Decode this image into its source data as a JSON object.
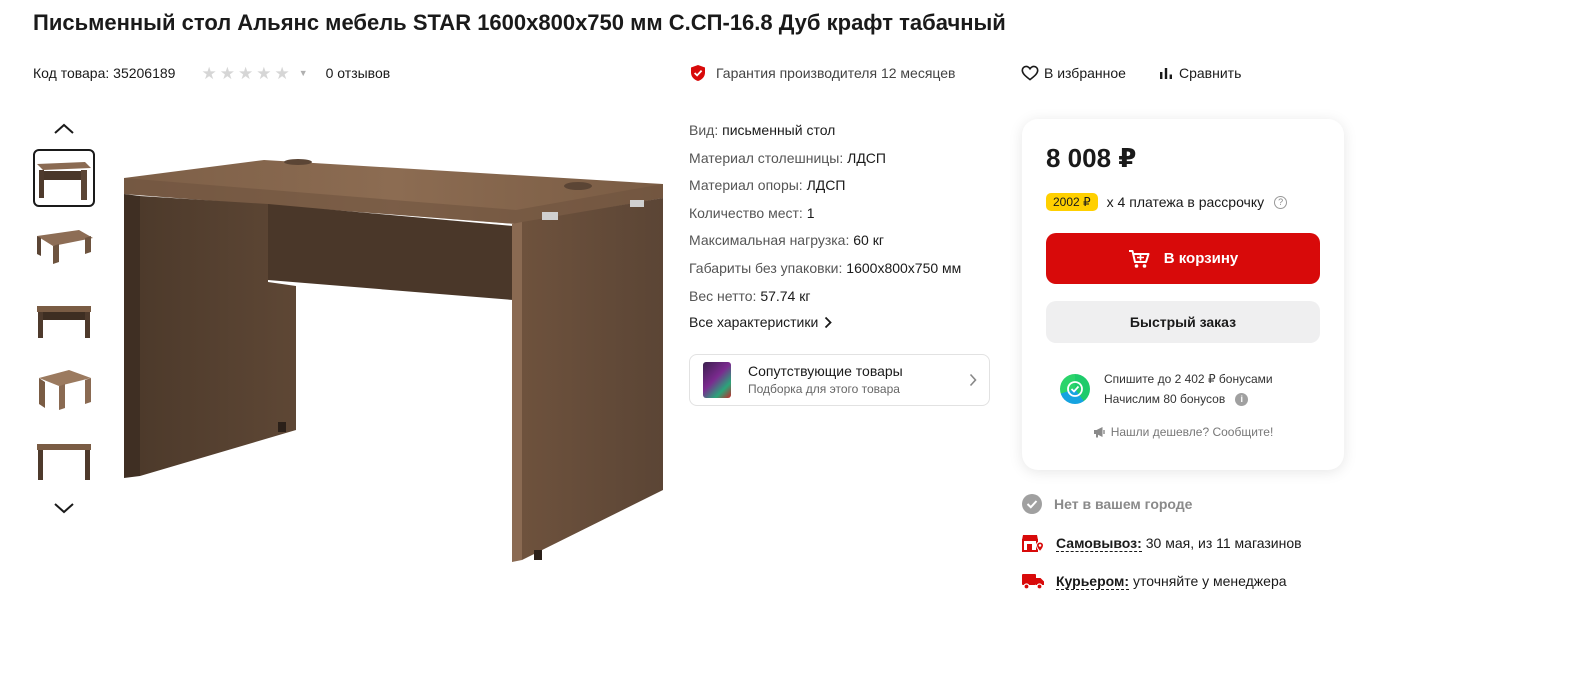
{
  "product": {
    "title": "Письменный стол Альянс мебель STAR 1600x800x750 мм С.СП-16.8 Дуб крафт табачный",
    "code_text": "Код товара: 35206189",
    "rating_stars": 0,
    "reviews_text": "0 отзывов",
    "warranty_text": "Гарантия производителя 12 месяцев",
    "favorite_label": "В избранное",
    "compare_label": "Сравнить"
  },
  "gallery": {
    "thumbnail_count": 5,
    "active_index": 0
  },
  "specs": [
    {
      "key": "Вид:",
      "value": "письменный стол"
    },
    {
      "key": "Материал столешницы:",
      "value": "ЛДСП"
    },
    {
      "key": "Материал опоры:",
      "value": "ЛДСП"
    },
    {
      "key": "Количество мест:",
      "value": "1"
    },
    {
      "key": "Максимальная нагрузка:",
      "value": "60 кг"
    },
    {
      "key": "Габариты без упаковки:",
      "value": "1600x800x750 мм"
    },
    {
      "key": "Вес нетто:",
      "value": "57.74 кг"
    }
  ],
  "all_specs_label": "Все характеристики",
  "related": {
    "title": "Сопутствующие товары",
    "subtitle": "Подборка для этого товара"
  },
  "buy": {
    "price": "8 008 ₽",
    "installment_badge": "2002 ₽",
    "installment_text": "х 4 платежа в рассрочку",
    "cart_label": "В корзину",
    "quick_order_label": "Быстрый заказ",
    "bonus_line1": "Спишите до 2 402 ₽ бонусами",
    "bonus_line2": "Начислим 80 бонусов",
    "cheaper_text": "Нашли дешевле? Сообщите!"
  },
  "delivery": {
    "availability": "Нет в вашем городе",
    "pickup_label": "Самовывоз:",
    "pickup_value": "30 мая, из 11 магазинов",
    "courier_label": "Курьером:",
    "courier_value": "уточняйте у менеджера"
  },
  "colors": {
    "accent_red": "#d80a0a",
    "badge_yellow": "#ffd000",
    "wood_dark": "#5b4535",
    "wood_mid": "#7a5c44"
  }
}
